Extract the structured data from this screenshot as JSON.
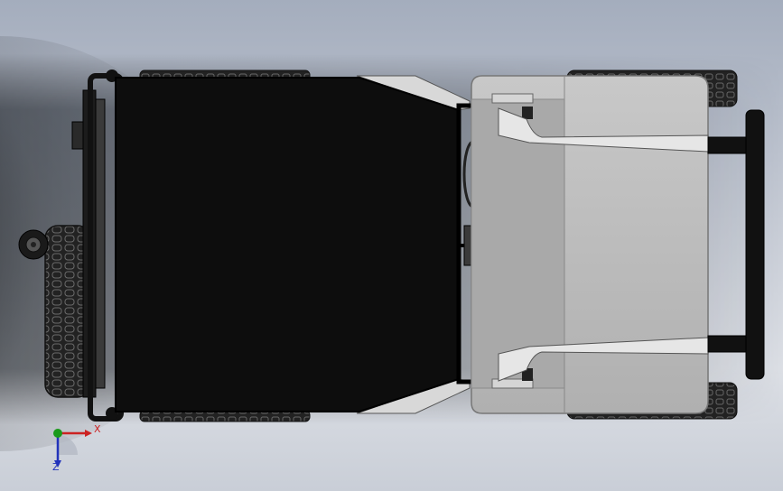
{
  "viewport": {
    "background_top": "#a4adbd",
    "background_bottom": "#dcdfe5"
  },
  "model": {
    "tub_color": "#0d0d0d",
    "hood_color": "#b3b3b3",
    "fender_color": "#d9d9d9",
    "tire_color": "#1a1a1a",
    "bumper_color": "#111111"
  },
  "triad": {
    "x_label": "X",
    "y_label": "Y",
    "z_label": "Z",
    "x_color": "#cc2222",
    "y_color": "#1a9a1a",
    "z_color": "#2233bb"
  }
}
